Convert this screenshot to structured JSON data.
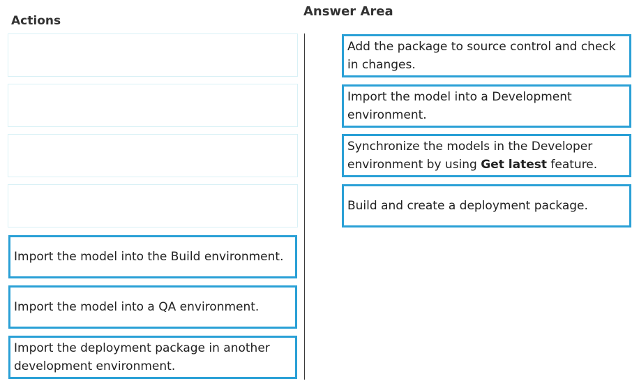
{
  "actions": {
    "heading": "Actions",
    "items": [
      "Import the model into the Build environment.",
      "Import the model into a QA environment.",
      "Import the deployment package in another development environment."
    ]
  },
  "answer_area": {
    "heading": "Answer Area",
    "items": [
      "Add the package to source control and check in changes.",
      "Import the model into a Development environment.",
      {
        "before": "Synchronize the models in the Developer environment by using ",
        "bold": "Get latest",
        "after": " feature."
      },
      "Build and create a deployment package."
    ]
  },
  "colors": {
    "card_border": "#2aa0d6",
    "empty_slot_border": "#d9f1f6"
  }
}
